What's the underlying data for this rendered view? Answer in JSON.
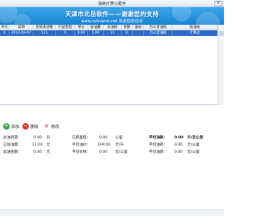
{
  "window": {
    "title": "油耗计算小助手",
    "close_label": "X"
  },
  "banner": {
    "title": "天津市北岳软件——谢谢您的支持",
    "subtitle": "www.netnamo.net 欢迎您的访问"
  },
  "table": {
    "columns": [
      "序号",
      "日期",
      "里程表读数",
      "行驶里程",
      "单价",
      "加油量",
      "总油耗",
      "金额",
      "油站",
      "百公里油耗",
      "加油站"
    ],
    "rows": [
      [
        "1",
        "2010-09-07",
        "111",
        "0",
        "0.00",
        "5.00",
        "11",
        "0",
        "",
        "百公里油耗",
        "计算过"
      ]
    ]
  },
  "toolbar": {
    "add": "添加",
    "delete": "删除",
    "edit": "修改"
  },
  "stats": {
    "total_fuel_label": "总油耗量：",
    "total_fuel_value": "0.00",
    "total_fuel_unit": "升",
    "add_fuel_label": "已加油量：",
    "add_fuel_value": "11.00",
    "add_fuel_unit": "元",
    "fuel_amount_label": "加油金额：",
    "fuel_amount_value": "0.00",
    "fuel_amount_unit": "元",
    "mileage_label": "已跑里程：",
    "mileage_value": "0.00",
    "mileage_unit": "公里",
    "avg_price_label": "平均油价：",
    "avg_price_value": "199.00",
    "avg_price_unit": "元/升",
    "avg_cost_label": "平均价格：",
    "avg_cost_value": "0.00",
    "avg_cost_unit": "元/公里",
    "avg_fuel_label": "平均油耗：",
    "avg_fuel_value": "0.00",
    "avg_fuel_unit": "升/百公里",
    "avg_fuel2_label": "平均油耗：",
    "avg_fuel2_value": "0.00",
    "avg_fuel2_unit": "元/公里",
    "extra_label": "平均油耗：",
    "extra_value": "0.00",
    "extra_unit": "元/公里"
  }
}
